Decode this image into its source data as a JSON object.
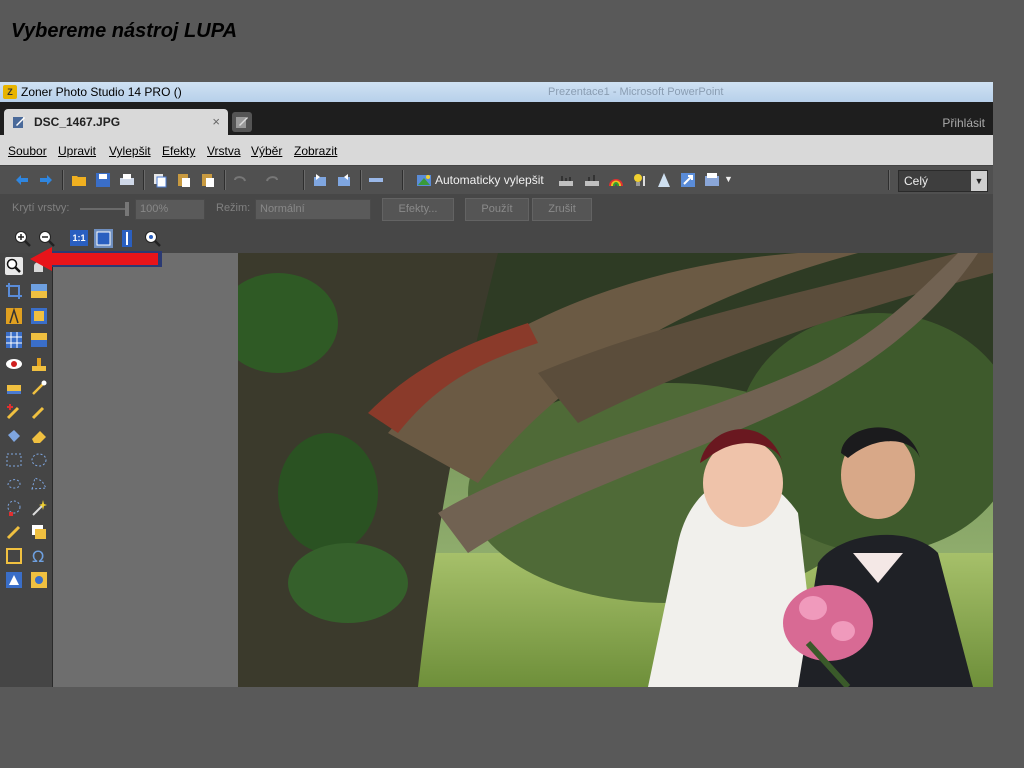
{
  "slide": {
    "title": "Vybereme nástroj LUPA"
  },
  "window": {
    "app_title": "Zoner Photo Studio 14 PRO  ()",
    "background_title": "Prezentace1 - Microsoft PowerPoint"
  },
  "tabs": [
    {
      "label": "DSC_1467.JPG",
      "close": "×"
    }
  ],
  "account": {
    "login": "Přihlásit"
  },
  "menu": [
    "Soubor",
    "Upravit",
    "Vylepšit",
    "Efekty",
    "Vrstva",
    "Výběr",
    "Zobrazit"
  ],
  "toolbar": {
    "auto_enhance_label": "Automaticky vylepšit",
    "zoom_select": {
      "value": "Celý"
    }
  },
  "layer_toolbar": {
    "opacity_label": "Krytí vrstvy:",
    "opacity_value": "100%",
    "mode_label": "Režim:",
    "mode_value": "Normální",
    "effects_button": "Efekty...",
    "apply_button": "Použít",
    "cancel_button": "Zrušit"
  },
  "zoom_toolbar": {
    "one_to_one": "1:1"
  },
  "tools": {
    "selected": "zoom-tool"
  },
  "colors": {
    "accent_arrow": "#e8141a",
    "photo_foliage": "#2e3b24"
  }
}
